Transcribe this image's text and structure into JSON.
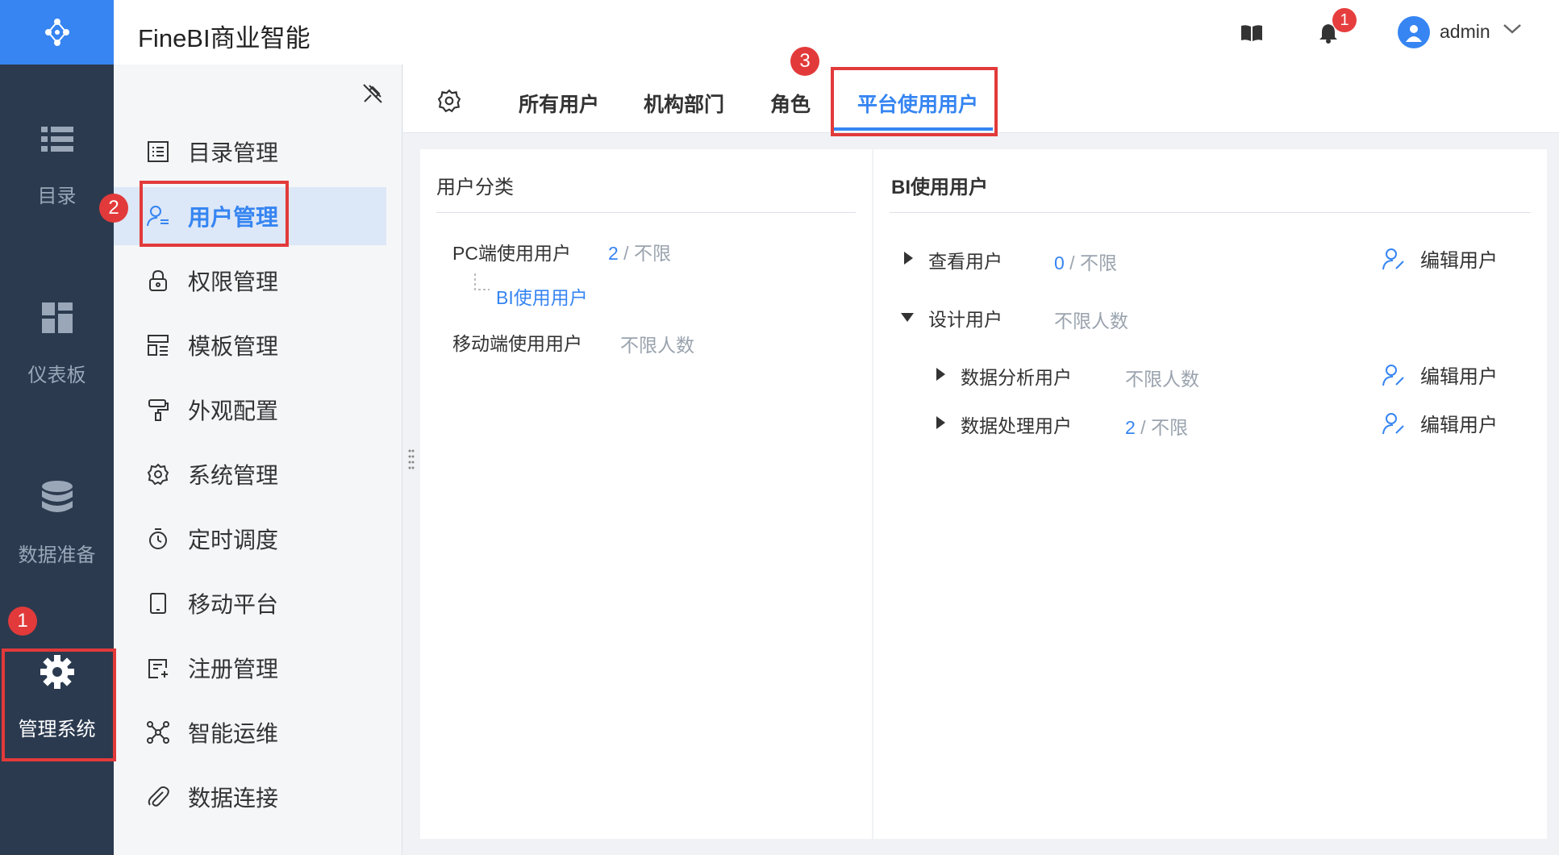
{
  "header": {
    "app_title": "FineBI商业智能",
    "notification_count": "1",
    "username": "admin"
  },
  "leftnav": {
    "items": [
      {
        "label": "目录",
        "icon": "list-icon"
      },
      {
        "label": "仪表板",
        "icon": "dashboard-icon"
      },
      {
        "label": "数据准备",
        "icon": "database-icon"
      },
      {
        "label": "管理系统",
        "icon": "gear-icon"
      }
    ]
  },
  "submenu": {
    "items": [
      {
        "label": "目录管理",
        "icon": "catalog-icon"
      },
      {
        "label": "用户管理",
        "icon": "user-icon"
      },
      {
        "label": "权限管理",
        "icon": "lock-icon"
      },
      {
        "label": "模板管理",
        "icon": "template-icon"
      },
      {
        "label": "外观配置",
        "icon": "paint-roller-icon"
      },
      {
        "label": "系统管理",
        "icon": "gear-icon"
      },
      {
        "label": "定时调度",
        "icon": "stopwatch-icon"
      },
      {
        "label": "移动平台",
        "icon": "tablet-icon"
      },
      {
        "label": "注册管理",
        "icon": "register-icon"
      },
      {
        "label": "智能运维",
        "icon": "network-icon"
      },
      {
        "label": "数据连接",
        "icon": "paperclip-icon"
      }
    ]
  },
  "tabs": {
    "items": [
      "所有用户",
      "机构部门",
      "角色",
      "平台使用用户"
    ],
    "active": "平台使用用户"
  },
  "left_panel": {
    "title": "用户分类",
    "pc_label": "PC端使用用户",
    "pc_count": "2",
    "pc_limit": " / 不限",
    "bi_users": "BI使用用户",
    "mobile_label": "移动端使用用户",
    "mobile_value": "不限人数"
  },
  "right_panel": {
    "title": "BI使用用户",
    "rows": [
      {
        "label": "查看用户",
        "count": "0",
        "limit": " / 不限",
        "edit": "编辑用户"
      },
      {
        "label": "设计用户",
        "value": "不限人数"
      },
      {
        "label": "数据分析用户",
        "value": "不限人数",
        "edit": "编辑用户"
      },
      {
        "label": "数据处理用户",
        "count": "2",
        "limit": " / 不限",
        "edit": "编辑用户"
      }
    ]
  },
  "annotations": [
    "1",
    "2",
    "3",
    "1"
  ],
  "colors": {
    "accent": "#3685f2",
    "nav_bg": "#2b3a4f",
    "annotation_red": "#e23a3a"
  }
}
